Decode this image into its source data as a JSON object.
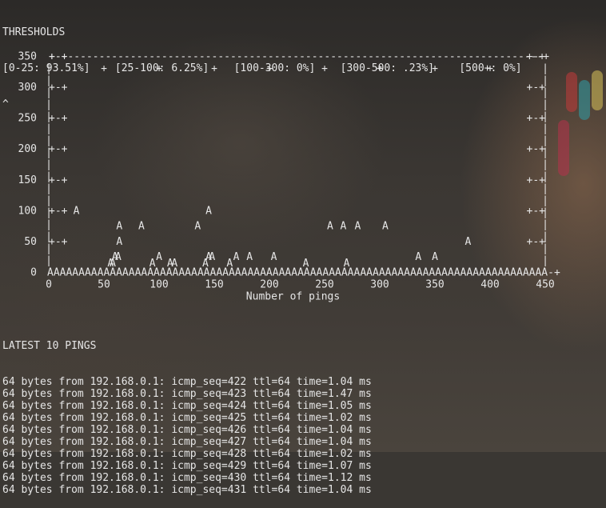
{
  "thresholds": {
    "title": "THRESHOLDS",
    "ranges_line": "[0-25: 93.51%]    [25-100: 6.25%]    [100-300: 0%]    [300-500: .23%]    [500+: 0%]",
    "caret": "^"
  },
  "chart_data": {
    "type": "scatter",
    "xlabel": "Number of pings",
    "ylabel": "",
    "xlim": [
      0,
      450
    ],
    "ylim": [
      0,
      350
    ],
    "x_ticks": [
      "0",
      "50",
      "100",
      "150",
      "200",
      "250",
      "300",
      "350",
      "400",
      "450"
    ],
    "y_ticks": [
      "0",
      "50",
      "100",
      "150",
      "200",
      "250",
      "300",
      "350"
    ],
    "marker": "A",
    "baseline_value": 0,
    "points": [
      [
        25,
        100
      ],
      [
        145,
        100
      ],
      [
        64,
        75
      ],
      [
        84,
        75
      ],
      [
        135,
        75
      ],
      [
        255,
        75
      ],
      [
        267,
        75
      ],
      [
        280,
        75
      ],
      [
        305,
        75
      ],
      [
        64,
        50
      ],
      [
        380,
        50
      ],
      [
        60,
        25
      ],
      [
        63,
        25
      ],
      [
        100,
        25
      ],
      [
        145,
        25
      ],
      [
        148,
        25
      ],
      [
        170,
        25
      ],
      [
        182,
        25
      ],
      [
        204,
        25
      ],
      [
        335,
        25
      ],
      [
        350,
        25
      ],
      [
        56,
        15
      ],
      [
        58,
        15
      ],
      [
        94,
        15
      ],
      [
        110,
        15
      ],
      [
        114,
        15
      ],
      [
        142,
        15
      ],
      [
        164,
        15
      ],
      [
        233,
        15
      ],
      [
        270,
        15
      ]
    ]
  },
  "pings": {
    "title": "LATEST 10 PINGS",
    "lines": [
      "64 bytes from 192.168.0.1: icmp_seq=422 ttl=64 time=1.04 ms",
      "64 bytes from 192.168.0.1: icmp_seq=423 ttl=64 time=1.47 ms",
      "64 bytes from 192.168.0.1: icmp_seq=424 ttl=64 time=1.05 ms",
      "64 bytes from 192.168.0.1: icmp_seq=425 ttl=64 time=1.02 ms",
      "64 bytes from 192.168.0.1: icmp_seq=426 ttl=64 time=1.04 ms",
      "64 bytes from 192.168.0.1: icmp_seq=427 ttl=64 time=1.04 ms",
      "64 bytes from 192.168.0.1: icmp_seq=428 ttl=64 time=1.02 ms",
      "64 bytes from 192.168.0.1: icmp_seq=429 ttl=64 time=1.07 ms",
      "64 bytes from 192.168.0.1: icmp_seq=430 ttl=64 time=1.12 ms",
      "64 bytes from 192.168.0.1: icmp_seq=431 ttl=64 time=1.04 ms"
    ]
  },
  "colors": {
    "text": "#e6e6e6",
    "background": "#3a3733"
  }
}
